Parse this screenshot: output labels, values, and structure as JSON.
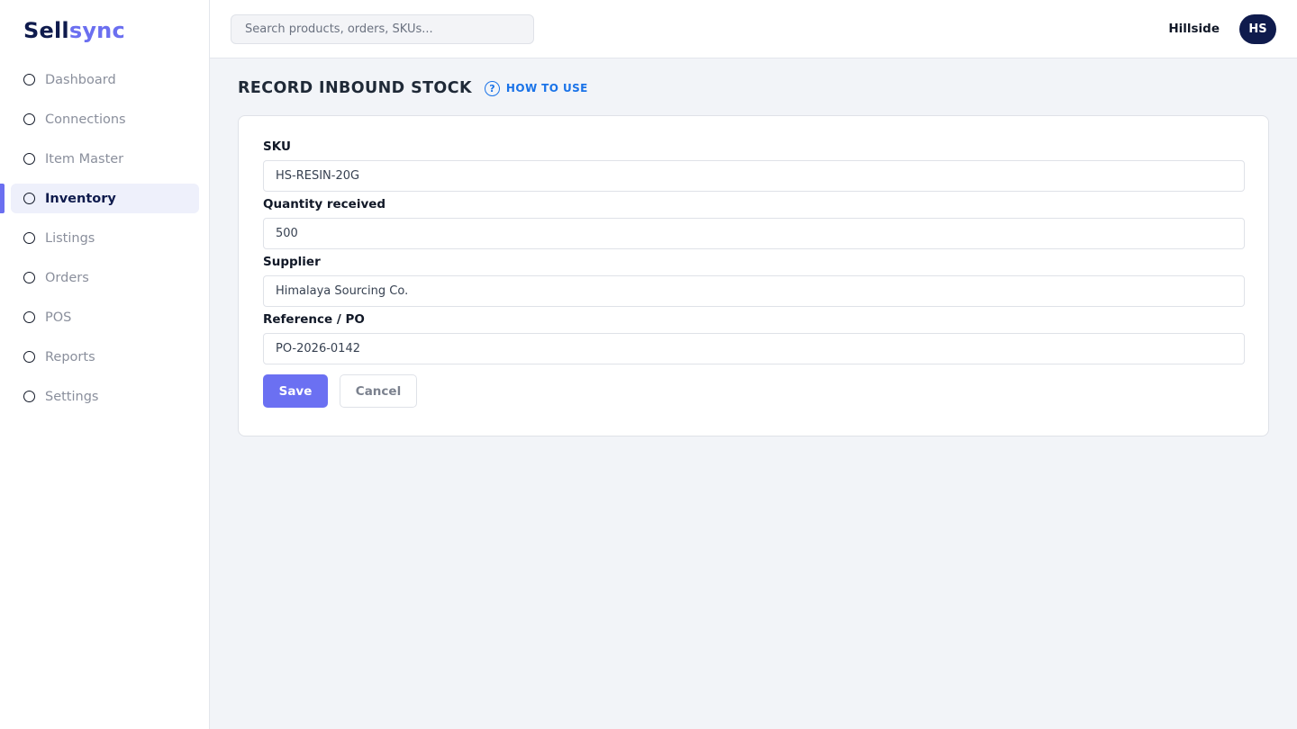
{
  "brand": {
    "part1": "Sell",
    "part2": "sync"
  },
  "search": {
    "placeholder": "Search products, orders, SKUs..."
  },
  "user": {
    "org": "Hillside",
    "initials": "HS"
  },
  "sidebar": {
    "items": [
      {
        "label": "Dashboard"
      },
      {
        "label": "Connections"
      },
      {
        "label": "Item Master"
      },
      {
        "label": "Inventory",
        "active": true
      },
      {
        "label": "Listings"
      },
      {
        "label": "Orders"
      },
      {
        "label": "POS"
      },
      {
        "label": "Reports"
      },
      {
        "label": "Settings"
      }
    ]
  },
  "page": {
    "title": "RECORD INBOUND STOCK",
    "help_icon": "question-circle-icon",
    "help_label": "HOW TO USE"
  },
  "form": {
    "sku": {
      "label": "SKU",
      "value": "HS-RESIN-20G"
    },
    "quantity": {
      "label": "Quantity received",
      "value": "500"
    },
    "supplier": {
      "label": "Supplier",
      "value": "Himalaya Sourcing Co."
    },
    "reference": {
      "label": "Reference / PO",
      "value": "PO-2026-0142"
    },
    "save_label": "Save",
    "cancel_label": "Cancel"
  },
  "colors": {
    "brand_dark": "#0f1b4d",
    "accent": "#6b6ff0",
    "link": "#1a73e8"
  }
}
